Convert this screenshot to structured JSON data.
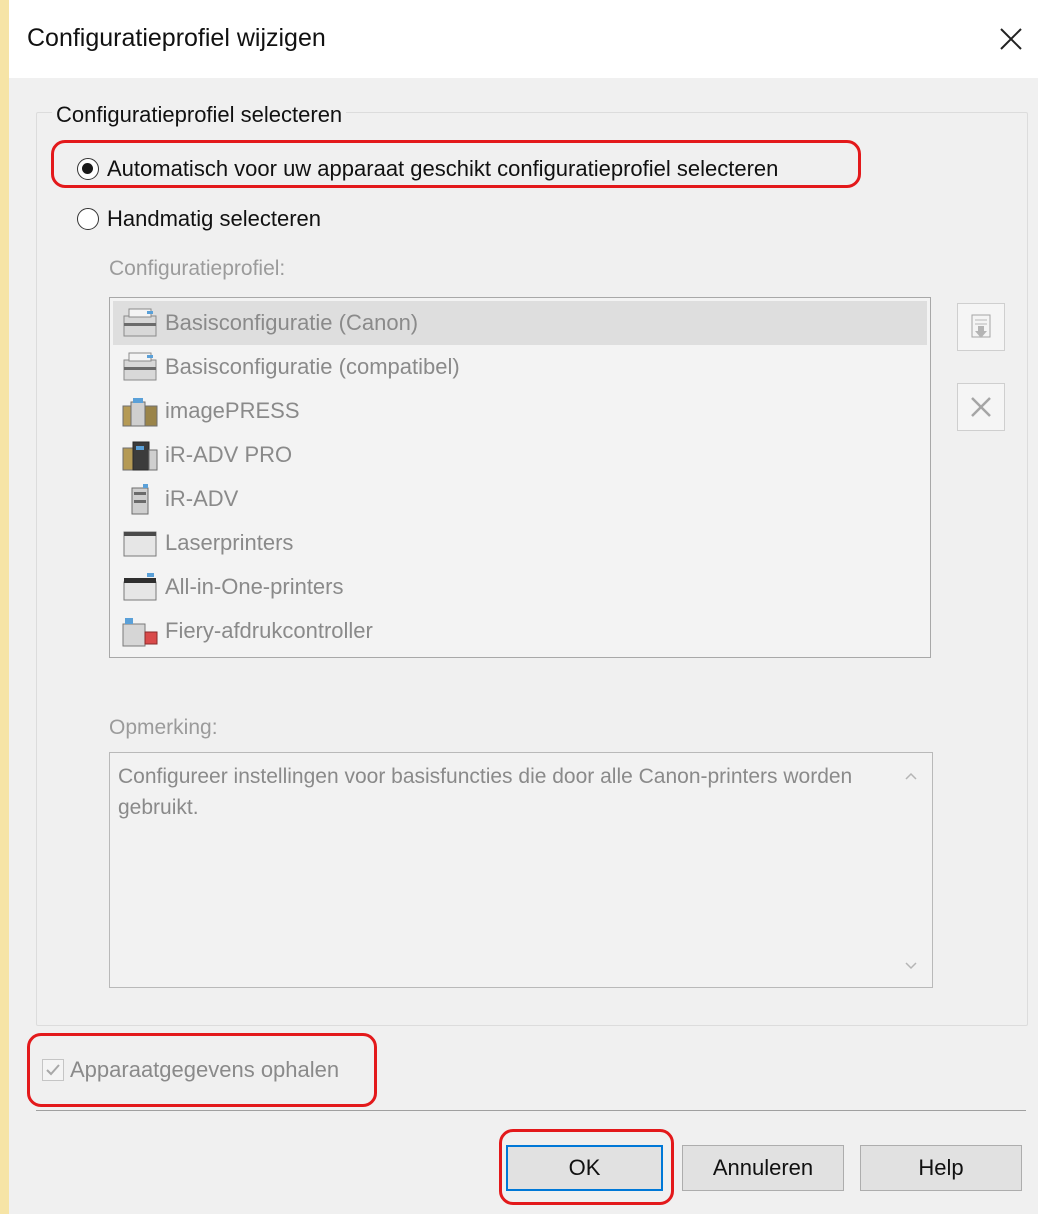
{
  "window": {
    "title": "Configuratieprofiel wijzigen"
  },
  "group": {
    "legend": "Configuratieprofiel selecteren"
  },
  "options": {
    "auto_label": "Automatisch voor uw apparaat geschikt configuratieprofiel selecteren",
    "auto_selected": true,
    "manual_label": "Handmatig selecteren",
    "manual_selected": false
  },
  "profiles": {
    "label": "Configuratieprofiel:",
    "selected_index": 0,
    "items": [
      {
        "label": "Basisconfiguratie (Canon)",
        "icon": "printer-icon"
      },
      {
        "label": "Basisconfiguratie (compatibel)",
        "icon": "printer-icon"
      },
      {
        "label": "imagePRESS",
        "icon": "production-press-icon"
      },
      {
        "label": "iR-ADV PRO",
        "icon": "production-printer-icon"
      },
      {
        "label": "iR-ADV",
        "icon": "multifunction-printer-icon"
      },
      {
        "label": "Laserprinters",
        "icon": "laser-printer-icon"
      },
      {
        "label": "All-in-One-printers",
        "icon": "all-in-one-printer-icon"
      },
      {
        "label": "Fiery-afdrukcontroller",
        "icon": "fiery-controller-icon"
      }
    ]
  },
  "side_buttons": {
    "import_icon": "import-icon",
    "delete_icon": "delete-icon"
  },
  "memo": {
    "label": "Opmerking:",
    "text": "Configureer instellingen voor basisfuncties die door alle Canon-printers worden gebruikt."
  },
  "device_info": {
    "label": "Apparaatgegevens ophalen",
    "checked": true
  },
  "buttons": {
    "ok": "OK",
    "cancel": "Annuleren",
    "help": "Help"
  },
  "colors": {
    "highlight": "#e3191b",
    "default_button_border": "#0078d7"
  }
}
